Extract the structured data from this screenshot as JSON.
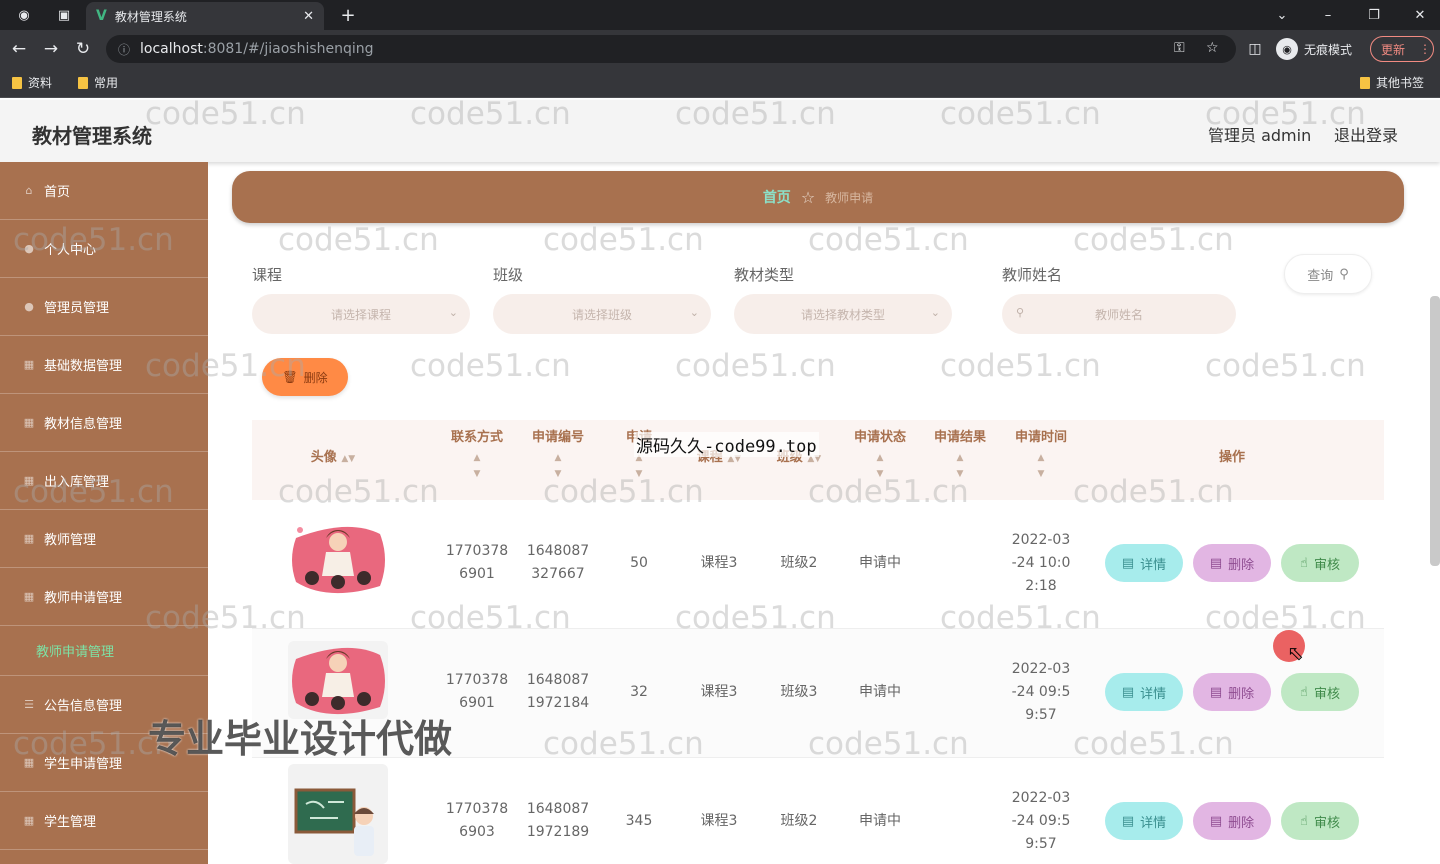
{
  "browser": {
    "tab_title": "教材管理系统",
    "tab_favicon": "V",
    "url_host": "localhost",
    "url_path": ":8081/#/jiaoshishenqing",
    "incognito_label": "无痕模式",
    "update_label": "更新",
    "bookmarks": [
      "资料",
      "常用"
    ],
    "other_bookmarks": "其他书签"
  },
  "header": {
    "app_title": "教材管理系统",
    "user_label": "管理员 admin",
    "logout_label": "退出登录"
  },
  "sidebar": {
    "items": [
      {
        "label": "首页"
      },
      {
        "label": "个人中心"
      },
      {
        "label": "管理员管理"
      },
      {
        "label": "基础数据管理"
      },
      {
        "label": "教材信息管理"
      },
      {
        "label": "出入库管理"
      },
      {
        "label": "教师管理"
      },
      {
        "label": "教师申请管理"
      }
    ],
    "sub_item": "教师申请管理",
    "items_after": [
      {
        "label": "公告信息管理"
      },
      {
        "label": "学生申请管理"
      },
      {
        "label": "学生管理"
      }
    ]
  },
  "breadcrumb": {
    "home": "首页",
    "current": "教师申请"
  },
  "filters": {
    "course_label": "课程",
    "course_placeholder": "请选择课程",
    "class_label": "班级",
    "class_placeholder": "请选择班级",
    "type_label": "教材类型",
    "type_placeholder": "请选择教材类型",
    "teacher_label": "教师姓名",
    "teacher_placeholder": "教师姓名",
    "query_label": "查询"
  },
  "toolbar": {
    "delete_label": "删除"
  },
  "table": {
    "headers": {
      "avatar": "头像",
      "contact": "联系方式",
      "apply_no": "申请编号",
      "apply_qty": "申请",
      "course": "课程",
      "class": "班级",
      "status": "申请状态",
      "result": "申请结果",
      "time": "申请时间",
      "ops": "操作"
    },
    "rows": [
      {
        "contact": "1770378\n6901",
        "apply_no": "1648087\n327667",
        "qty": "50",
        "course": "课程3",
        "class": "班级2",
        "status": "申请中",
        "result": "",
        "time": "2022-03\n-24 10:0\n2:18"
      },
      {
        "contact": "1770378\n6901",
        "apply_no": "1648087\n1972184",
        "qty": "32",
        "course": "课程3",
        "class": "班级3",
        "status": "申请中",
        "result": "",
        "time": "2022-03\n-24 09:5\n9:57"
      },
      {
        "contact": "1770378\n6903",
        "apply_no": "1648087\n1972189",
        "qty": "345",
        "course": "课程3",
        "class": "班级2",
        "status": "申请中",
        "result": "",
        "time": "2022-03\n-24 09:5\n9:57"
      }
    ],
    "actions": {
      "detail": "详情",
      "delete": "删除",
      "review": "审核"
    }
  },
  "overlays": {
    "watermark": "code51.cn",
    "banner_top": "源码久久-code99.top",
    "banner_bottom": "专业毕业设计代做"
  }
}
